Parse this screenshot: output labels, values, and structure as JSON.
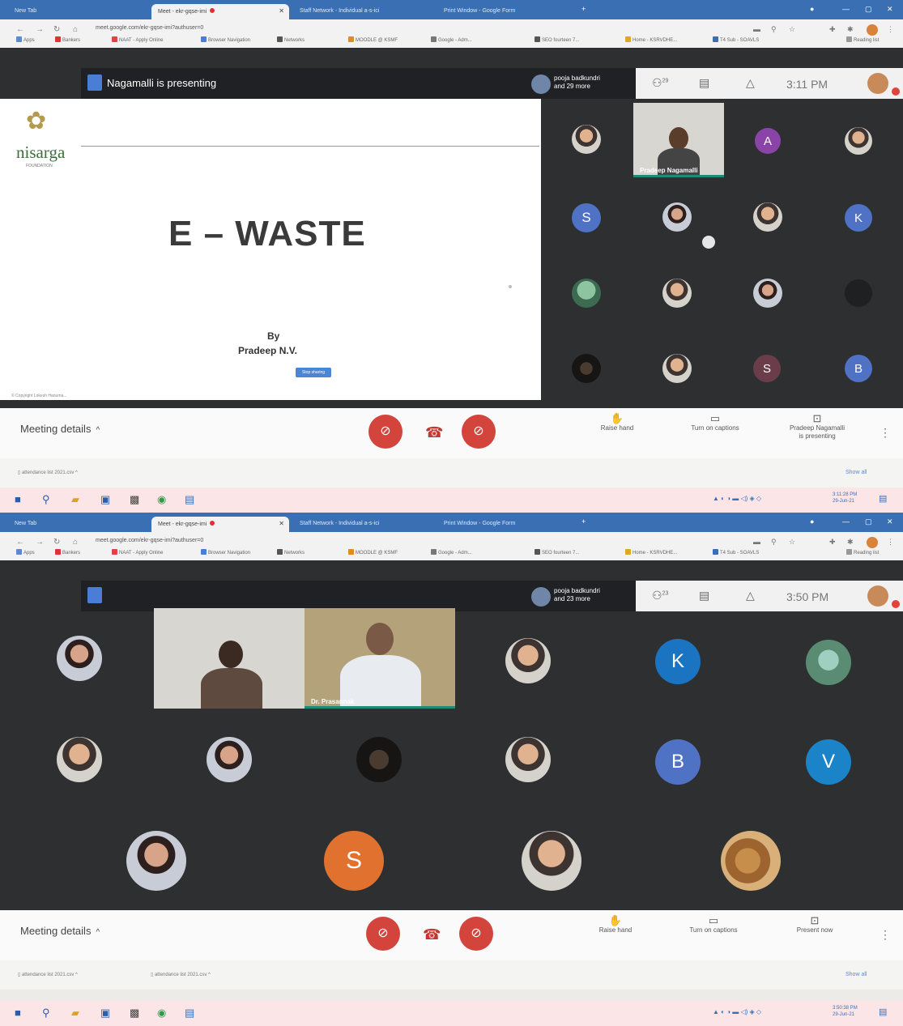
{
  "screen1": {
    "tabs": [
      "New Tab",
      "Meet - ekr-gqse-imi",
      "Staff Network - Individual a-s-ici",
      "Print Window - Google Form"
    ],
    "url": "meet.google.com/ekr-gqse-imi?authuser=0",
    "bookmarks": [
      "Apps",
      "Bankers",
      "NAAT - Apply Online",
      "Browser Navigation",
      "Networks",
      "MOODLE @ KSMF",
      "Google - Adm...",
      "SEO fourteen 7...",
      "Home - KSRVDHE...",
      "T4 Sub - SOAVLS",
      "Reading list"
    ],
    "presenting_label": "Nagamalli is presenting",
    "participants_chip": "pooja badkundri\nand 29 more",
    "people_count": "29",
    "time": "3:11 PM",
    "slide": {
      "logo": "nisarga",
      "logo_sub": "FOUNDATION",
      "title": "E – WASTE",
      "by": "By",
      "author": "Pradeep N.V.",
      "footer": "© Copyright Lokesh Hanuma...",
      "ctrl_btn": "Stop sharing"
    },
    "video_name": "Pradeep Nagamalli",
    "tiles": [
      "A",
      "S",
      "K",
      "S",
      "B"
    ],
    "meeting_details": "Meeting details",
    "raise_hand": "Raise hand",
    "captions": "Turn on captions",
    "presenting_action": "Pradeep Nagamalli\nis presenting",
    "download": "attendance list 2021.csv",
    "show_all": "Show all",
    "clock": "3:11:28 PM\n29-Jun-21"
  },
  "screen2": {
    "tabs": [
      "New Tab",
      "Meet - ekr-gqse-imi",
      "Staff Network - Individual a-s-ici",
      "Print Window - Google Form"
    ],
    "url": "meet.google.com/ekr-gqse-imi?authuser=0",
    "participants_chip": "pooja badkundri\nand 23 more",
    "people_count": "23",
    "time": "3:50 PM",
    "video_name": "Dr. Prasannak",
    "tiles": [
      "K",
      "B",
      "V",
      "S"
    ],
    "meeting_details": "Meeting details",
    "raise_hand": "Raise hand",
    "captions": "Turn on captions",
    "present_now": "Present now",
    "download1": "attendance list 2021.csv",
    "download2": "attendance list 2021.csv",
    "show_all": "Show all",
    "clock": "3:50:38 PM\n29-Jun-21"
  },
  "colors": {
    "tabstrip": "#3b6fb3",
    "meet_bg": "#2d2f31",
    "end_red": "#d3443c",
    "tile_purple": "#8a44a8",
    "tile_blue": "#4f72c4",
    "tile_rose": "#6b3d4a",
    "tile_orange": "#e1712f",
    "tile_k2": "#1a74c2",
    "tile_v": "#1b84c9"
  }
}
